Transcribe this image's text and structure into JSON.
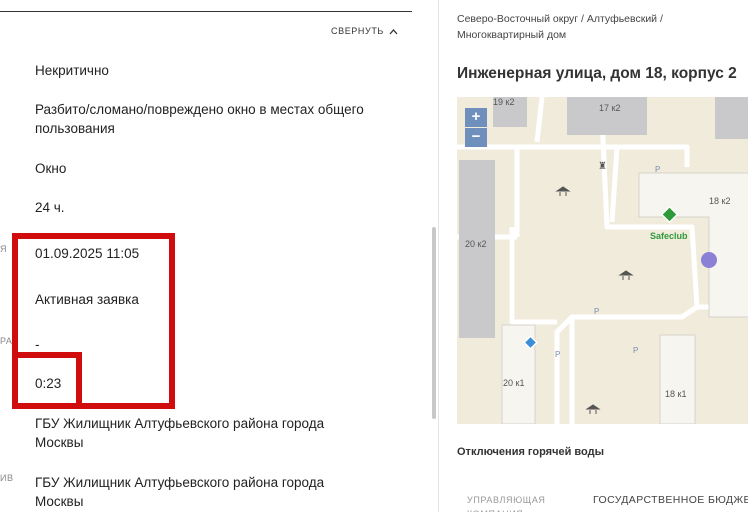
{
  "left": {
    "collapse_label": "СВЕРНУТЬ",
    "fields": {
      "criticality": "Некритично",
      "description": "Разбито/сломано/повреждено окно в местах общего пользования",
      "object": "Окно",
      "deadline": "24 ч.",
      "created_at": "01.09.2025 11:05",
      "status": "Активная заявка",
      "dash": "-",
      "elapsed": "0:23",
      "org_1": "ГБУ Жилищник Алтуфьевского района города Москвы",
      "org_2": "ГБУ Жилищник Алтуфьевского района города Москвы"
    },
    "label_fragments": {
      "f1": "Я",
      "f2": "РА:",
      "f3": "ИВ"
    }
  },
  "right": {
    "breadcrumb_line1": "Северо-Восточный округ / Алтуфьевский /",
    "breadcrumb_line2": "Многоквартирный дом",
    "address": "Инженерная улица, дом 18, корпус 2",
    "map": {
      "zoom_in": "+",
      "zoom_out": "−",
      "labels": {
        "b19k2": "19 к2",
        "b17k2": "17 к2",
        "b18k2": "18 к2",
        "b20k2": "20 к2",
        "b20k1": "20 к1",
        "b18k1": "18 к1",
        "safeclub": "Safeclub",
        "parking": "P"
      }
    },
    "section_title": "Отключения горячей воды",
    "company_label": "УПРАВЛЯЮЩАЯ КОМПАНИЯ",
    "company_value": "ГОСУДАРСТВЕННОЕ БЮДЖЕТ"
  },
  "colors": {
    "highlight": "#d10c0c",
    "map_bg": "#f0ebdb",
    "building": "#c9c9cc",
    "zoom": "#6f8fbd",
    "safeclub": "#2e9a3a",
    "purple_dot": "#8b7fd6"
  }
}
